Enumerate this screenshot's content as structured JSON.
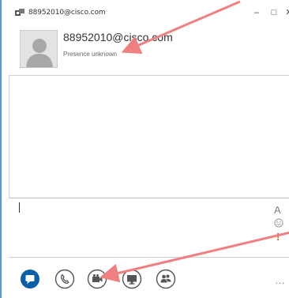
{
  "window": {
    "title": "88952010@cisco.com",
    "controls": {
      "minimize": "–",
      "maximize": "□",
      "close": "✕"
    }
  },
  "contact": {
    "name": "88952010@cisco.com",
    "presence": "Presence unknown"
  },
  "compose": {
    "font_button": "A",
    "important_button": "!"
  },
  "toolbar": {
    "items": [
      {
        "icon": "chat-icon"
      },
      {
        "icon": "phone-icon"
      },
      {
        "icon": "video-icon"
      },
      {
        "icon": "screen-share-icon"
      },
      {
        "icon": "people-icon"
      }
    ],
    "more": "…"
  },
  "colors": {
    "accent": "#0b5ea8",
    "arrow": "#f08080",
    "border": "#5a9bd5"
  }
}
